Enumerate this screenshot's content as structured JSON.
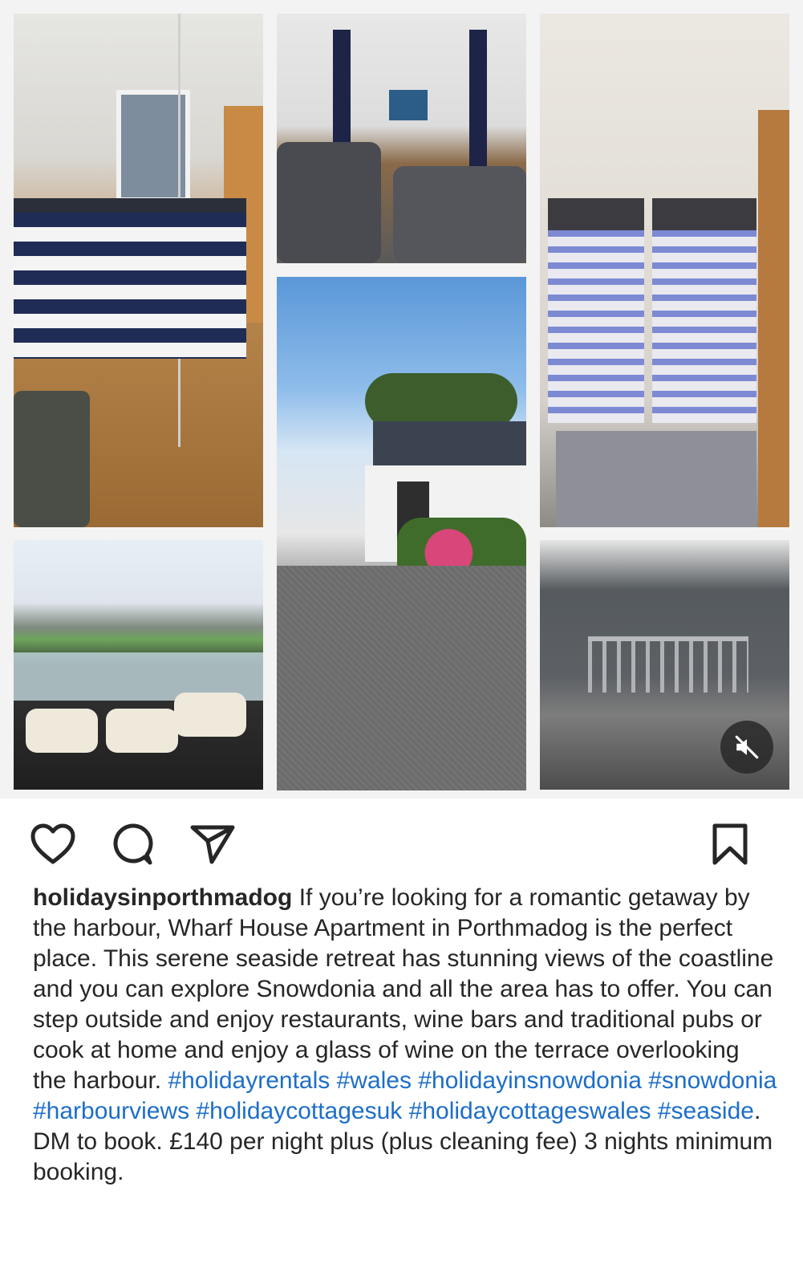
{
  "post": {
    "username": "holidaysinporthmadog",
    "caption_lead": "If you’re looking for a romantic getaway by the harbour, Wharf House Apartment in Porthmadog is the perfect place.  This serene seaside retreat has stunning views of the coastline and you can explore Snowdonia and all the area has to offer.  You can step outside and enjoy restaurants, wine bars and traditional pubs or cook at home and enjoy a glass of wine on the terrace overlooking the harbour.",
    "hashtags": [
      "#holidayrentals",
      "#wales",
      "#holidayinsnowdonia",
      "#snowdonia",
      "#harbourviews",
      "#holidaycottagesuk",
      "#holidaycottageswales",
      "#seaside"
    ],
    "caption_tail": ".  DM to book. £140 per night plus (plus cleaning fee) 3 nights minimum booking."
  },
  "media": {
    "photos": [
      {
        "name": "photo-double-bedroom"
      },
      {
        "name": "photo-living-room"
      },
      {
        "name": "photo-twin-bedroom"
      },
      {
        "name": "photo-courtyard"
      },
      {
        "name": "photo-harbour-balcony"
      },
      {
        "name": "photo-terrace"
      }
    ],
    "mute_icon": "speaker-muted-icon"
  },
  "actions": {
    "icons": [
      "heart-icon",
      "comment-icon",
      "share-icon",
      "bookmark-icon"
    ]
  },
  "colors": {
    "text": "#262626",
    "hashtag": "#1d6ec9",
    "collage_background": "#f3f3f3"
  }
}
